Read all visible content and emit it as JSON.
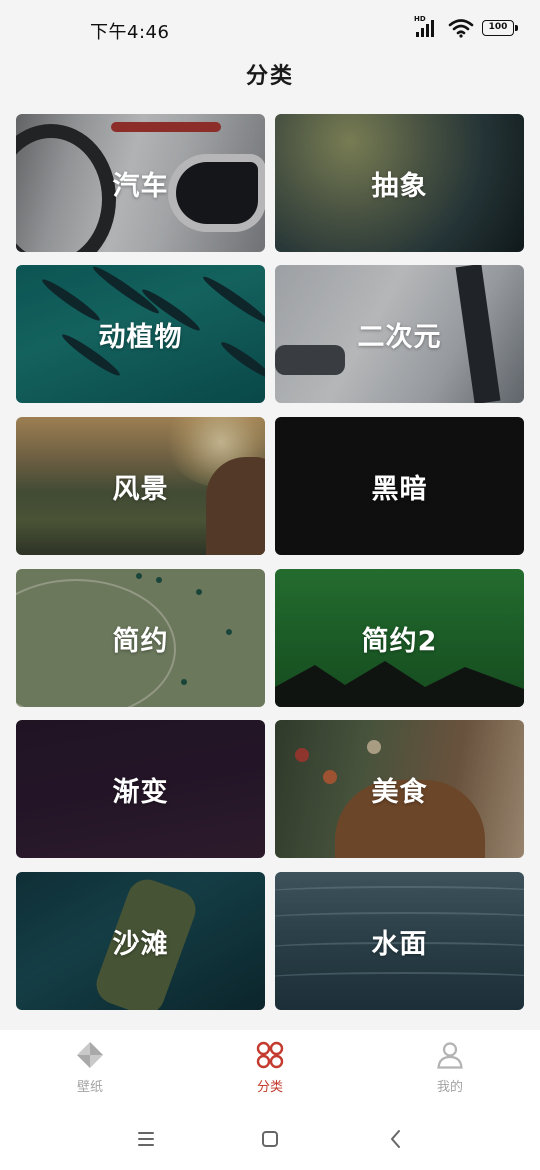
{
  "status_bar": {
    "time": "下午4:46",
    "signal_badge": "HD",
    "battery": "100"
  },
  "header": {
    "title": "分类"
  },
  "categories": [
    {
      "label": "汽车"
    },
    {
      "label": "抽象"
    },
    {
      "label": "动植物"
    },
    {
      "label": "二次元"
    },
    {
      "label": "风景"
    },
    {
      "label": "黑暗"
    },
    {
      "label": "简约"
    },
    {
      "label": "简约2"
    },
    {
      "label": "渐变"
    },
    {
      "label": "美食"
    },
    {
      "label": "沙滩"
    },
    {
      "label": "水面"
    }
  ],
  "bottom_nav": {
    "items": [
      {
        "label": "壁纸",
        "icon": "wallpaper-icon",
        "active": false
      },
      {
        "label": "分类",
        "icon": "category-icon",
        "active": true
      },
      {
        "label": "我的",
        "icon": "profile-icon",
        "active": false
      }
    ]
  },
  "system_nav": {
    "icons": [
      "menu-icon",
      "home-icon",
      "back-icon"
    ]
  },
  "colors": {
    "accent": "#c43a2e",
    "inactive": "#a3a3a3",
    "background": "#f4f4f4"
  }
}
